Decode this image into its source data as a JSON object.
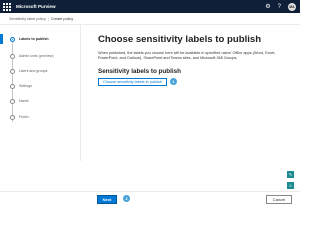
{
  "header": {
    "app_title": "Microsoft Purview",
    "icons": [
      "waffle-icon",
      "settings-icon",
      "help-icon",
      "avatar"
    ]
  },
  "breadcrumb": {
    "items": [
      "Sensitivity label policy",
      "Create policy"
    ]
  },
  "wizard": {
    "steps": [
      {
        "label": "Labels to publish",
        "active": true
      },
      {
        "label": "Admin units (preview)",
        "active": false
      },
      {
        "label": "Users and groups",
        "active": false
      },
      {
        "label": "Settings",
        "active": false
      },
      {
        "label": "Name",
        "active": false
      },
      {
        "label": "Finish",
        "active": false
      }
    ]
  },
  "main": {
    "title": "Choose sensitivity labels to publish",
    "description": "When published, the labels you choose here will be available in specified users' Office apps (Word, Excel, PowerPoint, and Outlook), SharePoint and Teams sites, and Microsoft 365 Groups.",
    "section_title": "Sensitivity labels to publish",
    "choose_link": "Choose sensitivity labels to publish",
    "callout_1": "1"
  },
  "footer": {
    "next_label": "Next",
    "cancel_label": "Cancel",
    "callout_2": "2"
  },
  "colors": {
    "header_bg": "#0f1f38",
    "accent": "#0078d4",
    "callout": "#46a3d9",
    "fab": "#1c8b92"
  }
}
